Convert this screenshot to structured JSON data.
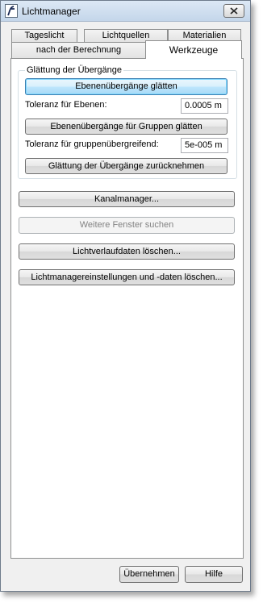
{
  "window": {
    "title": "Lichtmanager"
  },
  "tabs": {
    "row1": [
      "Tageslicht",
      "Lichtquellen",
      "Materialien"
    ],
    "row2_inactive": "nach der Berechnung",
    "row2_active": "Werkzeuge"
  },
  "group": {
    "title": "Glättung der Übergänge",
    "smooth_planes_button": "Ebenenübergänge glätten",
    "tolerance_planes_label": "Toleranz für Ebenen:",
    "tolerance_planes_value": "0.0005 m",
    "smooth_groups_button": "Ebenenübergänge für Gruppen glätten",
    "tolerance_groups_label": "Toleranz für gruppenübergreifend:",
    "tolerance_groups_value": "5e-005 m",
    "undo_smoothing_button": "Glättung der Übergänge zurücknehmen"
  },
  "actions": {
    "channel_manager": "Kanalmanager...",
    "find_windows": "Weitere Fenster suchen",
    "delete_light_history": "Lichtverlaufdaten löschen...",
    "delete_settings": "Lichtmanagereinstellungen und -daten löschen..."
  },
  "footer": {
    "apply": "Übernehmen",
    "help": "Hilfe"
  },
  "icons": {
    "app": "app-logo-icon",
    "close": "close-icon"
  }
}
